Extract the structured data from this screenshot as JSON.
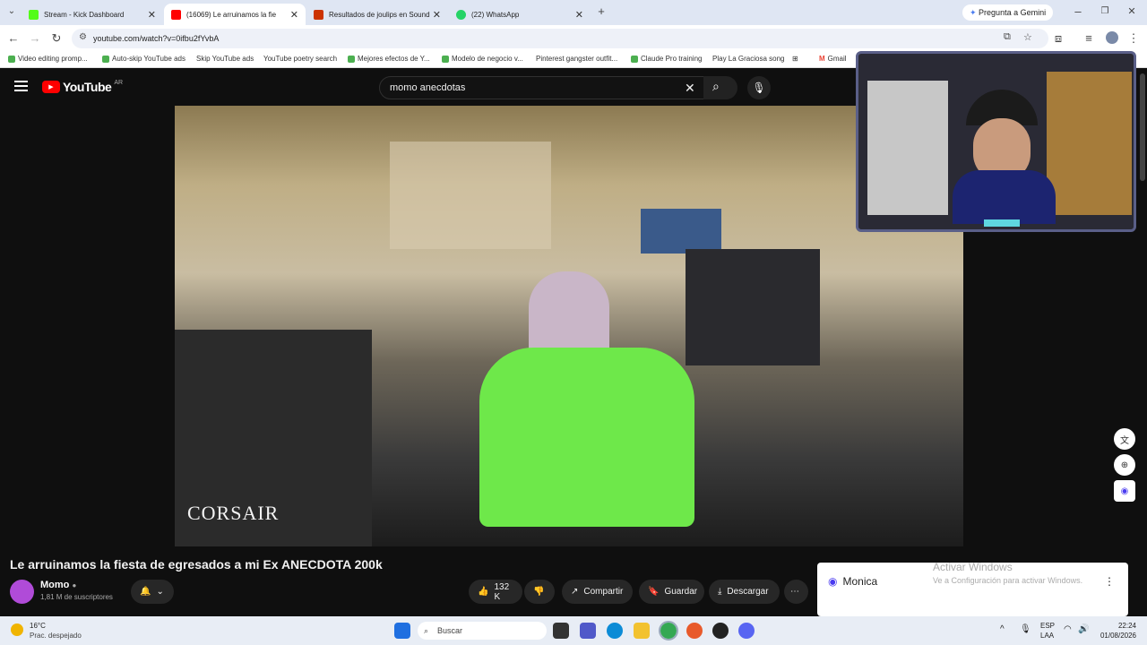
{
  "browser": {
    "tabs": [
      {
        "label": "Stream - Kick Dashboard",
        "color": "#53fc18"
      },
      {
        "label": "(16069) Le arruinamos la fie",
        "color": "#ff0000"
      },
      {
        "label": "Resultados de joulips en Sound",
        "color": "#ff5500"
      },
      {
        "label": "(22) WhatsApp",
        "color": "#25d366"
      }
    ],
    "gemini_label": "Pregunta a Gemini",
    "url": "youtube.com/watch?v=0ifbu2fYvbA",
    "bookmarks": [
      "Video editing promp...",
      "Auto-skip YouTube ads",
      "Skip YouTube ads",
      "YouTube poetry search",
      "Mejores efectos de Y...",
      "Modelo de negocio v...",
      "Pinterest gangster outfit...",
      "Claude Pro training",
      "Play La Graciosa song",
      "Gmail"
    ]
  },
  "youtube": {
    "logo_text": "YouTube",
    "region": "AR",
    "search_value": "momo anecdotas",
    "video_title": "Le arruinamos la fiesta de egresados a mi Ex ANECDOTA 200k",
    "channel": {
      "name": "Momo",
      "subscribers": "1,81 M de suscriptores"
    },
    "likes": "132 K",
    "actions": {
      "share": "Compartir",
      "save": "Guardar",
      "download": "Descargar"
    },
    "watermark": "CORSAIR"
  },
  "monica": {
    "title": "Monica"
  },
  "activate_windows": {
    "title": "Activar Windows",
    "subtitle": "Ve a Configuración para activar Windows."
  },
  "taskbar": {
    "weather_temp": "16°C",
    "weather_desc": "Prac. despejado",
    "search_placeholder": "Buscar",
    "lang": "ESP",
    "lang2": "LAA",
    "time": "22:24",
    "date": "01/08/2026"
  }
}
